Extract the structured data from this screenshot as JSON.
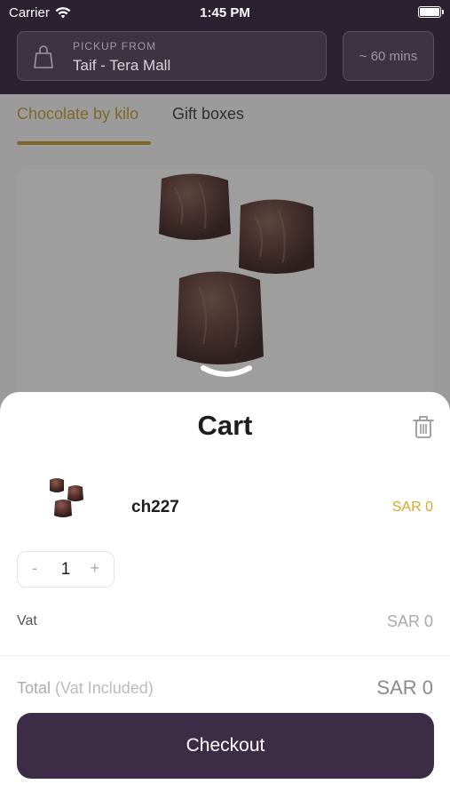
{
  "status_bar": {
    "carrier": "Carrier",
    "time": "1:45 PM"
  },
  "header": {
    "pickup_label": "PICKUP FROM",
    "pickup_location": "Taif - Tera Mall",
    "eta": "~ 60 mins"
  },
  "tabs": [
    {
      "label": "Chocolate by kilo",
      "active": true
    },
    {
      "label": "Gift boxes",
      "active": false
    }
  ],
  "cart": {
    "title": "Cart",
    "items": [
      {
        "name": "ch227",
        "price": "SAR 0",
        "quantity": "1"
      }
    ],
    "stepper": {
      "minus": "-",
      "plus": "+"
    },
    "vat_label": "Vat",
    "vat_value": "SAR 0",
    "total_label": "Total",
    "total_note": "(Vat Included)",
    "total_value": "SAR 0",
    "checkout_label": "Checkout"
  },
  "colors": {
    "header_bg": "#2c2130",
    "accent": "#c99a2a",
    "price": "#d9a82a",
    "checkout_bg": "#3c2c45"
  },
  "icons": [
    "wifi-icon",
    "battery-icon",
    "shopping-bag-icon",
    "chevron-down-icon",
    "trash-icon"
  ]
}
